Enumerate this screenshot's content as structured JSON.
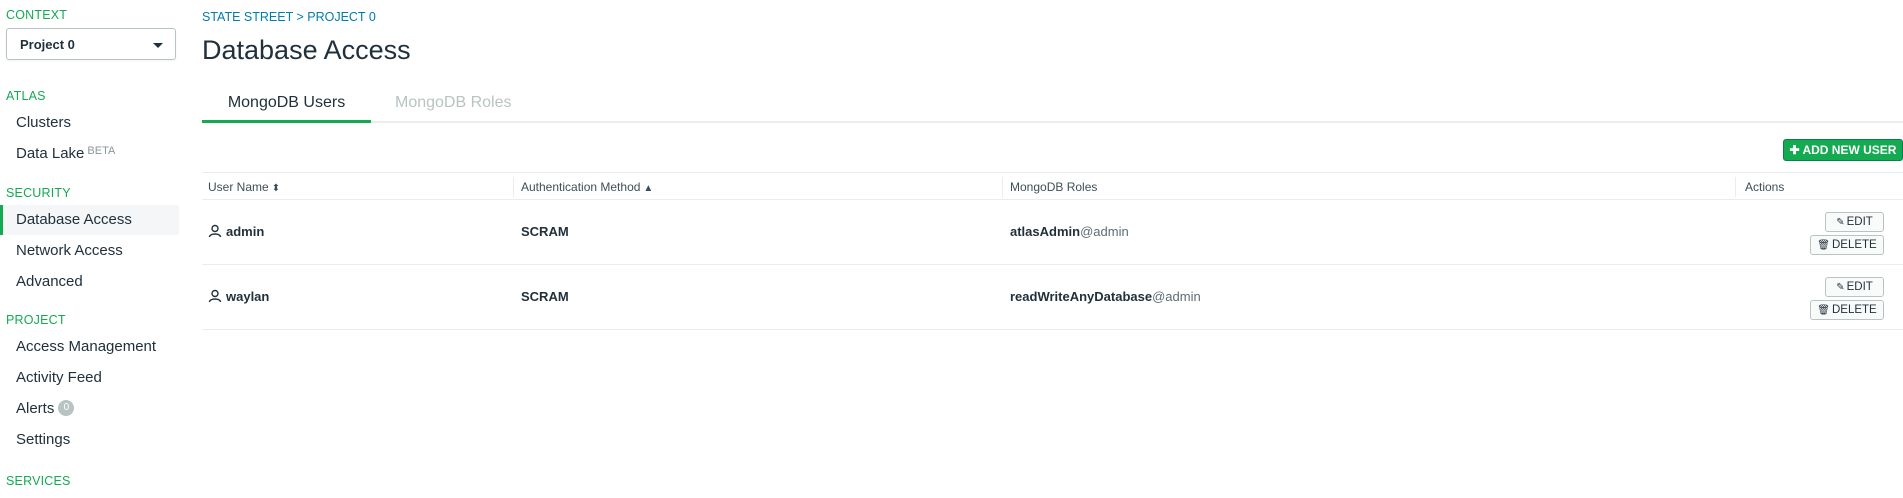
{
  "sidebar": {
    "context_title": "CONTEXT",
    "context_value": "Project 0",
    "atlas_title": "ATLAS",
    "atlas_items": [
      {
        "label": "Clusters"
      },
      {
        "label": "Data Lake",
        "badge": "BETA"
      }
    ],
    "security_title": "SECURITY",
    "security_items": [
      {
        "label": "Database Access",
        "active": true
      },
      {
        "label": "Network Access"
      },
      {
        "label": "Advanced"
      }
    ],
    "project_title": "PROJECT",
    "project_items": [
      {
        "label": "Access Management"
      },
      {
        "label": "Activity Feed"
      },
      {
        "label": "Alerts",
        "count": "0"
      },
      {
        "label": "Settings"
      }
    ],
    "services_title": "SERVICES"
  },
  "header": {
    "breadcrumb": "STATE STREET > PROJECT 0",
    "title": "Database Access"
  },
  "tabs": [
    {
      "label": "MongoDB Users",
      "active": true
    },
    {
      "label": "MongoDB Roles",
      "active": false
    }
  ],
  "toolbar": {
    "add_user_label": "ADD NEW USER"
  },
  "table": {
    "columns": [
      "User Name",
      "Authentication Method",
      "MongoDB Roles",
      "Actions"
    ],
    "rows": [
      {
        "user": "admin",
        "method": "SCRAM",
        "role_name": "atlasAdmin",
        "role_db": "@admin",
        "edit": "EDIT",
        "delete": "DELETE"
      },
      {
        "user": "waylan",
        "method": "SCRAM",
        "role_name": "readWriteAnyDatabase",
        "role_db": "@admin",
        "edit": "EDIT",
        "delete": "DELETE"
      }
    ]
  },
  "colors": {
    "accent_green": "#13aa52",
    "link_blue": "#007cad",
    "border": "#e7eeec"
  }
}
